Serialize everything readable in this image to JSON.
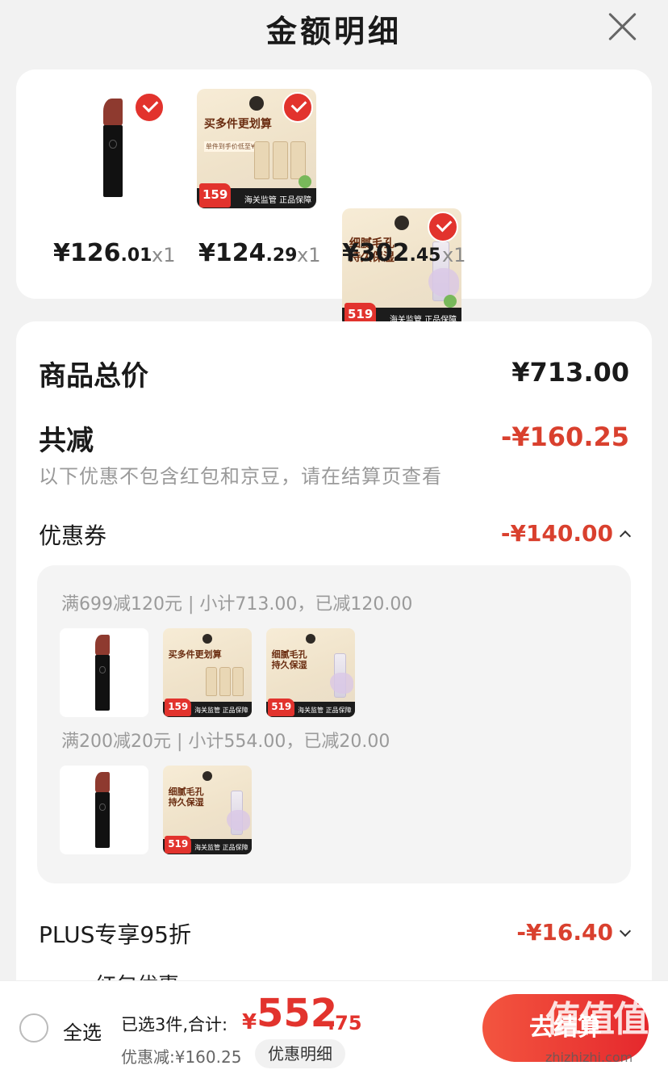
{
  "header": {
    "title": "金额明细"
  },
  "products": [
    {
      "name": "lipstick",
      "price_int": "¥126",
      "price_dec": ".01",
      "qty": "x1"
    },
    {
      "name": "foundation",
      "price_int": "¥124",
      "price_dec": ".29",
      "qty": "x1",
      "promo_head": "买多件更划算",
      "promo_sub": "单件到手价低至¥53",
      "promo_price": "159",
      "band_text": "海关监管 正品保障"
    },
    {
      "name": "lotion",
      "price_int": "¥302",
      "price_dec": ".45",
      "qty": "x1",
      "promo_head": "细腻毛孔\n持久保湿",
      "promo_price": "519",
      "band_text": "海关监管 正品保障"
    }
  ],
  "detail": {
    "total_label": "商品总价",
    "total_value": "¥713.00",
    "reduce_label": "共减",
    "reduce_value": "-¥160.25",
    "note": "以下优惠不包含红包和京豆，请在结算页查看",
    "coupon_label": "优惠券",
    "coupon_value": "-¥140.00",
    "coupon_rules": [
      "满699减120元 | 小计713.00，已减120.00",
      "满200减20元 | 小计554.00，已减20.00"
    ],
    "plus_label": "PLUS专享95折",
    "plus_value": "-¥16.40",
    "cutoff_text": "红包优惠"
  },
  "bottom": {
    "select_all": "全选",
    "summary": "已选3件,合计:",
    "total_symbol": "¥",
    "total_int": "552",
    "total_dec": ".75",
    "discount": "优惠减:¥160.25",
    "detail_button": "优惠明细",
    "checkout_button": "去结算"
  },
  "watermark": {
    "logo": "值值值",
    "url": "zhizhizhi.com"
  },
  "colors": {
    "accent": "#e2332d",
    "discount_red": "#d9402e",
    "background": "#f2f2f2"
  }
}
